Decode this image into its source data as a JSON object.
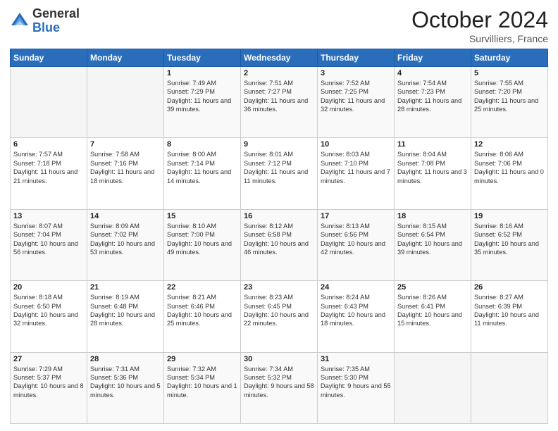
{
  "header": {
    "logo_general": "General",
    "logo_blue": "Blue",
    "month_title": "October 2024",
    "location": "Survilliers, France"
  },
  "weekdays": [
    "Sunday",
    "Monday",
    "Tuesday",
    "Wednesday",
    "Thursday",
    "Friday",
    "Saturday"
  ],
  "weeks": [
    [
      {
        "day": "",
        "info": ""
      },
      {
        "day": "",
        "info": ""
      },
      {
        "day": "1",
        "info": "Sunrise: 7:49 AM\nSunset: 7:29 PM\nDaylight: 11 hours and 39 minutes."
      },
      {
        "day": "2",
        "info": "Sunrise: 7:51 AM\nSunset: 7:27 PM\nDaylight: 11 hours and 36 minutes."
      },
      {
        "day": "3",
        "info": "Sunrise: 7:52 AM\nSunset: 7:25 PM\nDaylight: 11 hours and 32 minutes."
      },
      {
        "day": "4",
        "info": "Sunrise: 7:54 AM\nSunset: 7:23 PM\nDaylight: 11 hours and 28 minutes."
      },
      {
        "day": "5",
        "info": "Sunrise: 7:55 AM\nSunset: 7:20 PM\nDaylight: 11 hours and 25 minutes."
      }
    ],
    [
      {
        "day": "6",
        "info": "Sunrise: 7:57 AM\nSunset: 7:18 PM\nDaylight: 11 hours and 21 minutes."
      },
      {
        "day": "7",
        "info": "Sunrise: 7:58 AM\nSunset: 7:16 PM\nDaylight: 11 hours and 18 minutes."
      },
      {
        "day": "8",
        "info": "Sunrise: 8:00 AM\nSunset: 7:14 PM\nDaylight: 11 hours and 14 minutes."
      },
      {
        "day": "9",
        "info": "Sunrise: 8:01 AM\nSunset: 7:12 PM\nDaylight: 11 hours and 11 minutes."
      },
      {
        "day": "10",
        "info": "Sunrise: 8:03 AM\nSunset: 7:10 PM\nDaylight: 11 hours and 7 minutes."
      },
      {
        "day": "11",
        "info": "Sunrise: 8:04 AM\nSunset: 7:08 PM\nDaylight: 11 hours and 3 minutes."
      },
      {
        "day": "12",
        "info": "Sunrise: 8:06 AM\nSunset: 7:06 PM\nDaylight: 11 hours and 0 minutes."
      }
    ],
    [
      {
        "day": "13",
        "info": "Sunrise: 8:07 AM\nSunset: 7:04 PM\nDaylight: 10 hours and 56 minutes."
      },
      {
        "day": "14",
        "info": "Sunrise: 8:09 AM\nSunset: 7:02 PM\nDaylight: 10 hours and 53 minutes."
      },
      {
        "day": "15",
        "info": "Sunrise: 8:10 AM\nSunset: 7:00 PM\nDaylight: 10 hours and 49 minutes."
      },
      {
        "day": "16",
        "info": "Sunrise: 8:12 AM\nSunset: 6:58 PM\nDaylight: 10 hours and 46 minutes."
      },
      {
        "day": "17",
        "info": "Sunrise: 8:13 AM\nSunset: 6:56 PM\nDaylight: 10 hours and 42 minutes."
      },
      {
        "day": "18",
        "info": "Sunrise: 8:15 AM\nSunset: 6:54 PM\nDaylight: 10 hours and 39 minutes."
      },
      {
        "day": "19",
        "info": "Sunrise: 8:16 AM\nSunset: 6:52 PM\nDaylight: 10 hours and 35 minutes."
      }
    ],
    [
      {
        "day": "20",
        "info": "Sunrise: 8:18 AM\nSunset: 6:50 PM\nDaylight: 10 hours and 32 minutes."
      },
      {
        "day": "21",
        "info": "Sunrise: 8:19 AM\nSunset: 6:48 PM\nDaylight: 10 hours and 28 minutes."
      },
      {
        "day": "22",
        "info": "Sunrise: 8:21 AM\nSunset: 6:46 PM\nDaylight: 10 hours and 25 minutes."
      },
      {
        "day": "23",
        "info": "Sunrise: 8:23 AM\nSunset: 6:45 PM\nDaylight: 10 hours and 22 minutes."
      },
      {
        "day": "24",
        "info": "Sunrise: 8:24 AM\nSunset: 6:43 PM\nDaylight: 10 hours and 18 minutes."
      },
      {
        "day": "25",
        "info": "Sunrise: 8:26 AM\nSunset: 6:41 PM\nDaylight: 10 hours and 15 minutes."
      },
      {
        "day": "26",
        "info": "Sunrise: 8:27 AM\nSunset: 6:39 PM\nDaylight: 10 hours and 11 minutes."
      }
    ],
    [
      {
        "day": "27",
        "info": "Sunrise: 7:29 AM\nSunset: 5:37 PM\nDaylight: 10 hours and 8 minutes."
      },
      {
        "day": "28",
        "info": "Sunrise: 7:31 AM\nSunset: 5:36 PM\nDaylight: 10 hours and 5 minutes."
      },
      {
        "day": "29",
        "info": "Sunrise: 7:32 AM\nSunset: 5:34 PM\nDaylight: 10 hours and 1 minute."
      },
      {
        "day": "30",
        "info": "Sunrise: 7:34 AM\nSunset: 5:32 PM\nDaylight: 9 hours and 58 minutes."
      },
      {
        "day": "31",
        "info": "Sunrise: 7:35 AM\nSunset: 5:30 PM\nDaylight: 9 hours and 55 minutes."
      },
      {
        "day": "",
        "info": ""
      },
      {
        "day": "",
        "info": ""
      }
    ]
  ]
}
